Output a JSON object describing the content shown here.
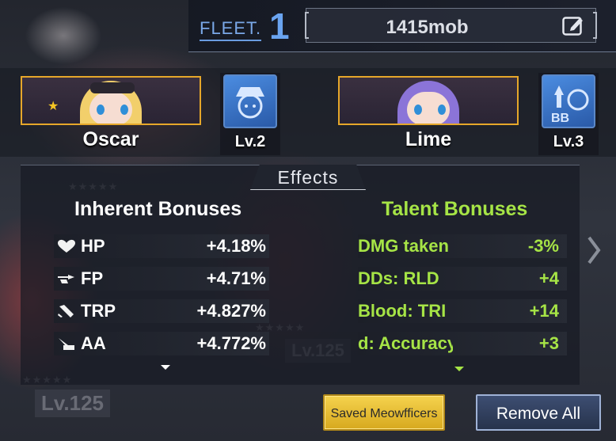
{
  "header": {
    "fleet_label": "FLEET.",
    "fleet_number": "1",
    "fleet_name": "1415mob",
    "edit_icon": "edit-icon"
  },
  "officers": [
    {
      "name": "Oscar",
      "skill_level": "Lv.2",
      "hair_color": "#f2cf6b",
      "portrait_icon": "blonde-cat-girl-portrait"
    },
    {
      "name": "Lime",
      "skill_level": "Lv.3",
      "hair_color": "#8b74d8",
      "portrait_icon": "purple-haired-girl-portrait"
    }
  ],
  "effects": {
    "title": "Effects",
    "inherent": {
      "heading": "Inherent Bonuses",
      "rows": [
        {
          "icon": "heart-icon",
          "label": "HP",
          "value": "+4.18%"
        },
        {
          "icon": "firepower-icon",
          "label": "FP",
          "value": "+4.71%"
        },
        {
          "icon": "torpedo-icon",
          "label": "TRP",
          "value": "+4.827%"
        },
        {
          "icon": "anti-air-icon",
          "label": "AA",
          "value": "+4.772%"
        }
      ]
    },
    "talent": {
      "heading": "Talent Bonuses",
      "rows": [
        {
          "label": "DMG taken",
          "value": "-3%"
        },
        {
          "label": "DDs: RLD",
          "value": "+4"
        },
        {
          "label": "Blood: TRI",
          "value": "+14"
        },
        {
          "label": "d: Accuracy",
          "value": "+3"
        }
      ]
    }
  },
  "background": {
    "level_label": "Lv.125"
  },
  "buttons": {
    "saved": "Saved Meowfficers",
    "remove_all": "Remove All"
  },
  "colors": {
    "accent_gold": "#e6a72a",
    "talent_green": "#a6e446",
    "fleet_blue": "#6aa4f0"
  }
}
